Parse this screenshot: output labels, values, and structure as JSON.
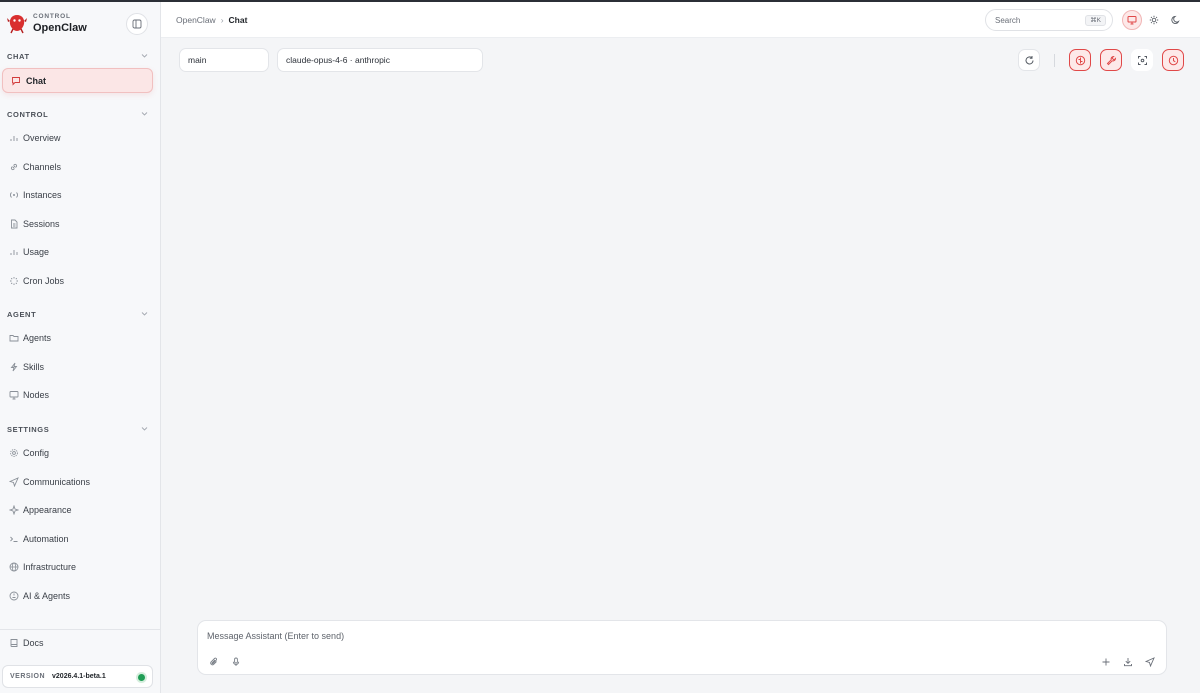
{
  "brand": {
    "subtitle": "CONTROL",
    "title": "OpenClaw"
  },
  "sections": {
    "chat": "CHAT",
    "control": "CONTROL",
    "agent": "AGENT",
    "settings": "SETTINGS"
  },
  "nav": {
    "chat": "Chat",
    "overview": "Overview",
    "channels": "Channels",
    "instances": "Instances",
    "sessions": "Sessions",
    "usage": "Usage",
    "cron_jobs": "Cron Jobs",
    "agents": "Agents",
    "skills": "Skills",
    "nodes": "Nodes",
    "config": "Config",
    "communications": "Communications",
    "appearance": "Appearance",
    "automation": "Automation",
    "infrastructure": "Infrastructure",
    "ai_agents": "AI & Agents",
    "docs": "Docs"
  },
  "version": {
    "label": "VERSION",
    "value": "v2026.4.1-beta.1",
    "status_color": "#1f9d55"
  },
  "breadcrumb": {
    "root": "OpenClaw",
    "separator": "›",
    "current": "Chat"
  },
  "search": {
    "placeholder": "Search",
    "shortcut": "⌘K"
  },
  "toolbar": {
    "session": "main",
    "model": "claude-opus-4-6 · anthropic"
  },
  "composer": {
    "placeholder": "Message Assistant (Enter to send)"
  },
  "icons": {
    "logo": "lobster-logo",
    "collapse": "sidebar-collapse-icon",
    "refresh": "refresh-icon",
    "accent": "#e04848"
  }
}
